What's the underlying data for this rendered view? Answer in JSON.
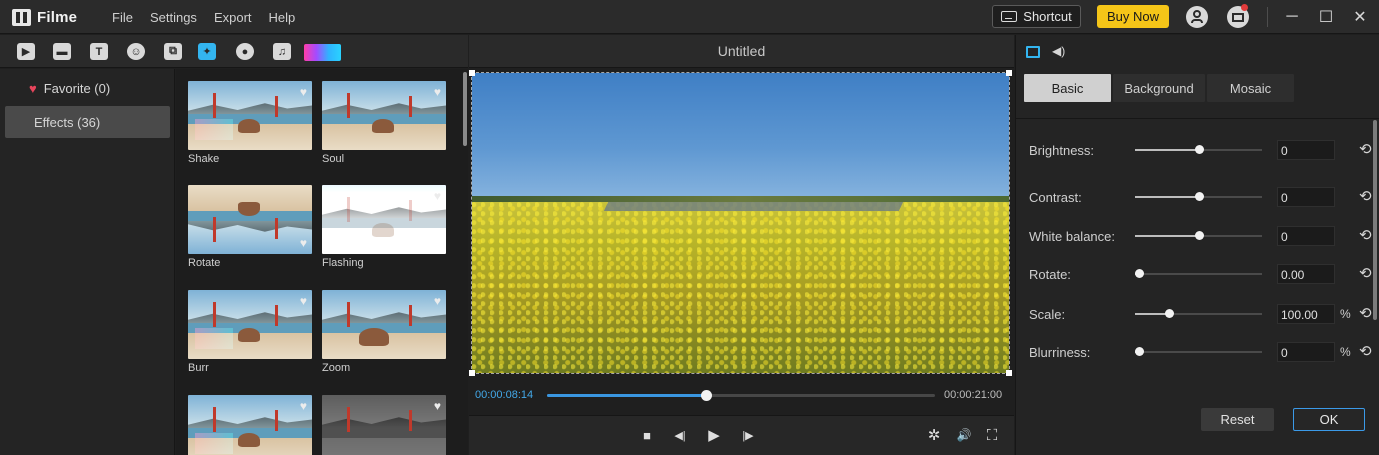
{
  "app": {
    "name": "Filme"
  },
  "menu": [
    "File",
    "Settings",
    "Export",
    "Help"
  ],
  "titlebar": {
    "shortcut_label": "Shortcut",
    "buy_label": "Buy Now",
    "buy_color": "#f5c518",
    "minimize_glyph": "─",
    "maximize_glyph": "☐",
    "close_glyph": "✕"
  },
  "media_tools": [
    "video-icon",
    "folder-icon",
    "text-icon",
    "sticker-icon",
    "transition-icon",
    "effects-icon",
    "filter-icon",
    "music-icon",
    "color-gradient-icon"
  ],
  "categories": {
    "favorite_label": "Favorite (0)",
    "effects_label": "Effects (36)"
  },
  "effects": [
    {
      "label": "Shake"
    },
    {
      "label": "Soul"
    },
    {
      "label": "Rotate"
    },
    {
      "label": "Flashing"
    },
    {
      "label": "Burr"
    },
    {
      "label": "Zoom"
    },
    {
      "label": ""
    },
    {
      "label": ""
    }
  ],
  "preview": {
    "title": "Untitled",
    "current_time": "00:00:08:14",
    "total_time": "00:00:21:00",
    "progress_fraction": 0.41
  },
  "controls": {
    "stop": "■",
    "prev_frame": "◀|",
    "play": "▶",
    "next_frame": "|▶",
    "settings": "✲",
    "volume": "🔊",
    "fullscreen": "⛶"
  },
  "props": {
    "tabs": [
      "Basic",
      "Background",
      "Mosaic"
    ],
    "active_tab": "Basic",
    "rows": [
      {
        "label": "Brightness:",
        "value": "0",
        "unit": "",
        "level": 0.5
      },
      {
        "label": "Contrast:",
        "value": "0",
        "unit": "",
        "level": 0.5
      },
      {
        "label": "White balance:",
        "value": "0",
        "unit": "",
        "level": 0.5
      },
      {
        "label": "Rotate:",
        "value": "0.00",
        "unit": "",
        "level": 0.03
      },
      {
        "label": "Scale:",
        "value": "100.00",
        "unit": "%",
        "level": 0.27
      },
      {
        "label": "Blurriness:",
        "value": "0",
        "unit": "%",
        "level": 0.03
      }
    ],
    "reset_label": "Reset",
    "ok_label": "OK",
    "reset_glyph": "⟲"
  }
}
